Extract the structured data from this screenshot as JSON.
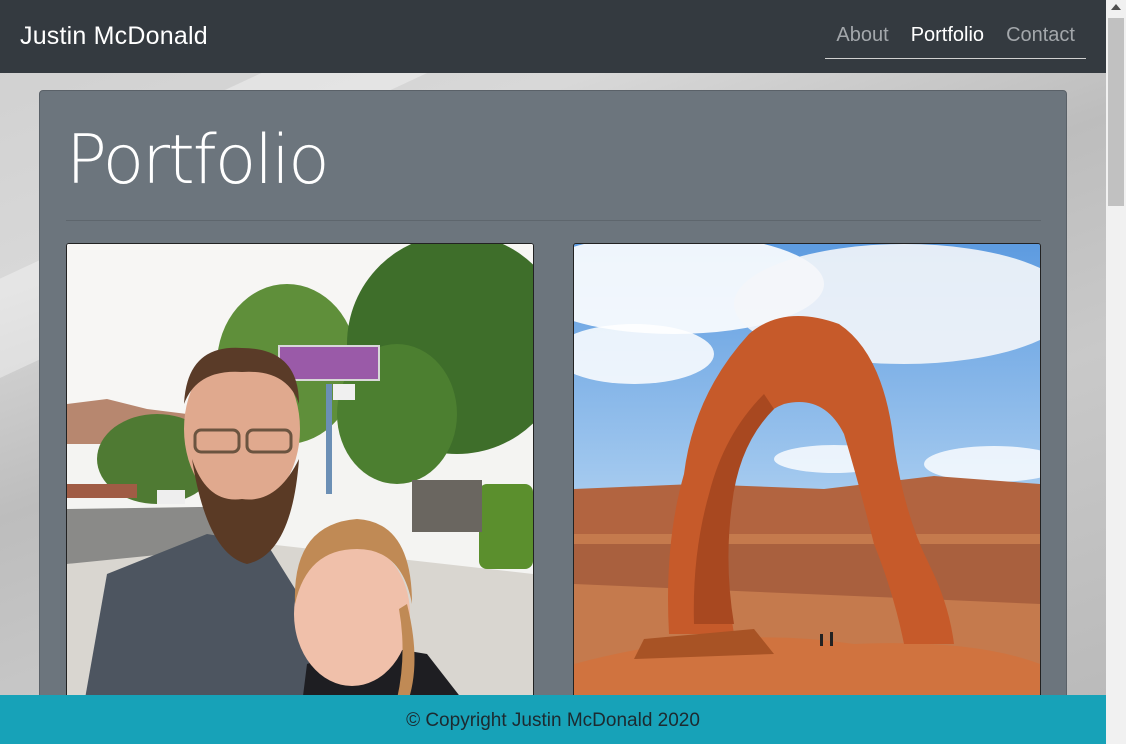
{
  "navbar": {
    "brand": "Justin McDonald",
    "links": [
      {
        "label": "About",
        "active": false
      },
      {
        "label": "Portfolio",
        "active": true
      },
      {
        "label": "Contact",
        "active": false
      }
    ]
  },
  "main": {
    "title": "Portfolio",
    "photos": [
      {
        "icon": "selfie-couple-photo"
      },
      {
        "icon": "delicate-arch-photo"
      }
    ]
  },
  "footer": {
    "text": "© Copyright Justin McDonald 2020"
  },
  "colors": {
    "navbar": "#343a40",
    "card": "#6c757d",
    "footer": "#17a2b8"
  }
}
